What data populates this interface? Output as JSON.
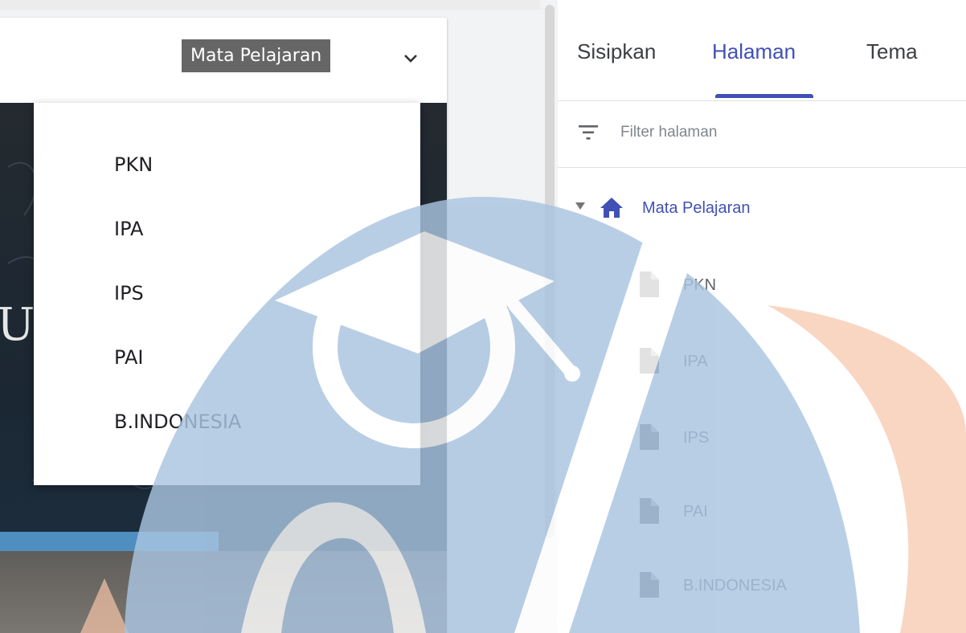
{
  "preview": {
    "nav_button_label": "Mata Pelajaran",
    "hero_text": "U",
    "dropdown_items": [
      "PKN",
      "IPA",
      "IPS",
      "PAI",
      "B.INDONESIA"
    ]
  },
  "editor": {
    "tabs": [
      {
        "label": "Sisipkan",
        "active": false
      },
      {
        "label": "Halaman",
        "active": true
      },
      {
        "label": "Tema",
        "active": false
      }
    ],
    "filter_placeholder": "Filter halaman",
    "tree": {
      "root_label": "Mata Pelajaran",
      "root_icon": "home-icon",
      "pages": [
        {
          "label": "PKN",
          "icon": "page-icon"
        },
        {
          "label": "IPA",
          "icon": "page-icon"
        },
        {
          "label": "IPS",
          "icon": "page-icon"
        },
        {
          "label": "PAI",
          "icon": "page-icon"
        },
        {
          "label": "B.INDONESIA",
          "icon": "page-icon"
        }
      ]
    }
  },
  "colors": {
    "accent": "#3f51b5",
    "nav_button_bg": "#666666",
    "watermark_blue": "#a9c4e0",
    "watermark_orange": "#f7c4a8"
  }
}
